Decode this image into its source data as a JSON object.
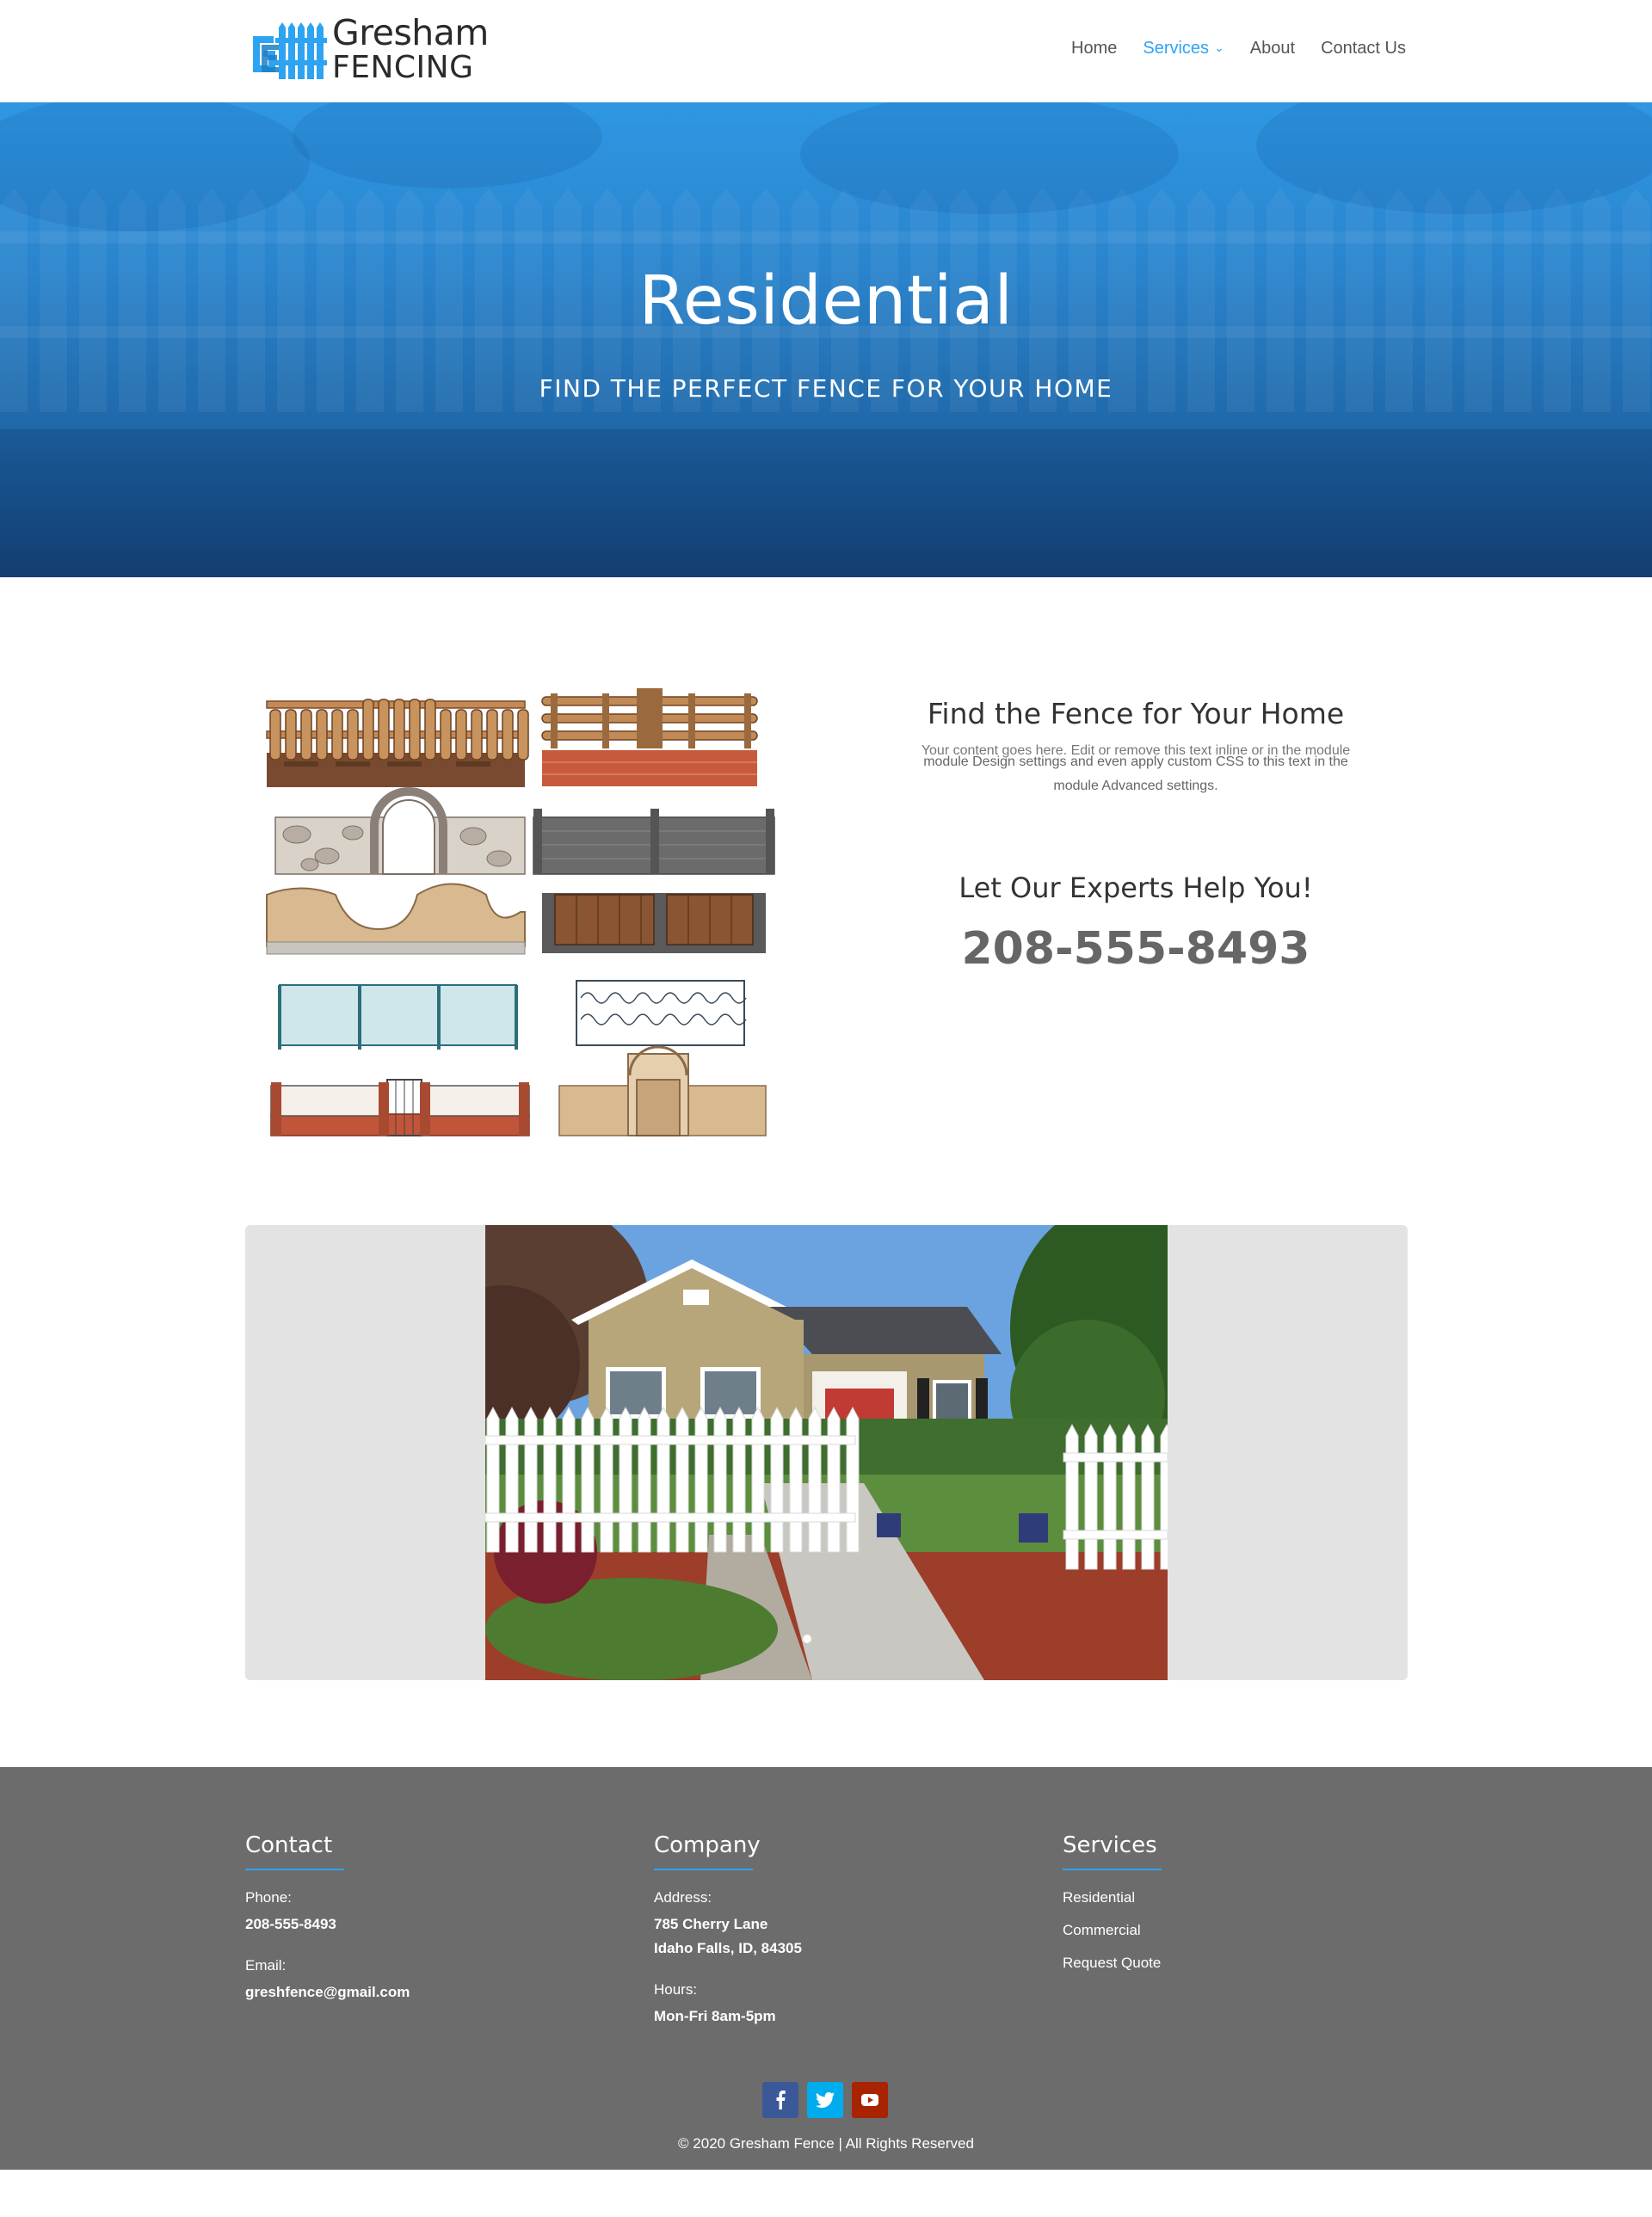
{
  "brand": {
    "name_line1": "Gresham",
    "name_line2": "FENCING",
    "accent_color": "#2ea3f2"
  },
  "nav": {
    "items": [
      {
        "label": "Home"
      },
      {
        "label": "Services",
        "active": true,
        "has_dropdown": true
      },
      {
        "label": "About"
      },
      {
        "label": "Contact Us"
      }
    ]
  },
  "hero": {
    "title": "Residential",
    "subtitle": "FIND THE PERFECT FENCE FOR YOUR HOME"
  },
  "content": {
    "find_title": "Find the Fence for Your Home",
    "find_body_overlap": "Your content goes here. Edit or remove this text inline or in the module",
    "find_body_line1": "module Design settings and even apply custom CSS to this text in the",
    "find_body_line2": "module Advanced settings.",
    "experts_title": "Let Our Experts Help You!",
    "phone": "208-555-8493"
  },
  "slider": {
    "image": "house-with-white-picket-fence-photo"
  },
  "footer": {
    "contact": {
      "heading": "Contact",
      "phone_label": "Phone:",
      "phone": "208-555-8493",
      "email_label": "Email:",
      "email": "greshfence@gmail.com"
    },
    "company": {
      "heading": "Company",
      "address_label": "Address:",
      "address_line1": "785 Cherry Lane",
      "address_line2": "Idaho Falls, ID, 84305",
      "hours_label": "Hours:",
      "hours": "Mon-Fri 8am-5pm"
    },
    "services": {
      "heading": "Services",
      "links": [
        "Residential",
        "Commercial",
        "Request Quote"
      ]
    },
    "social": [
      "facebook-icon",
      "twitter-icon",
      "youtube-icon"
    ],
    "copyright": "© 2020 Gresham Fence | All Rights Reserved"
  }
}
